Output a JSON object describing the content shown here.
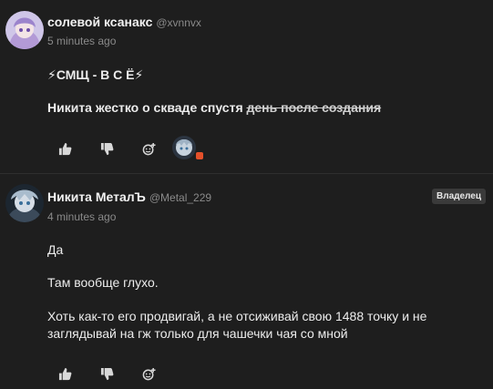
{
  "posts": [
    {
      "author": "солевой ксанакс",
      "handle": "@xvnnvx",
      "time": "5 minutes ago",
      "lines": {
        "l1": "⚡СМЩ - В С Ё⚡",
        "l2_main": "Никита жестко о скваде спустя",
        "l2_strike": "день после создания"
      }
    },
    {
      "author": "Никита МеталЪ",
      "handle": "@Metal_229",
      "time": "4 minutes ago",
      "badge": "Владелец",
      "lines": {
        "l1": "Да",
        "l2": "Там вообще глухо.",
        "l3a": "Хоть как-то его продвигай, а не отсиживай свою 1488 точку и не",
        "l3b": "заглядывай на гж только для чашечки чая со мной"
      }
    }
  ],
  "icons": {
    "like": "thumbs-up-icon",
    "dislike": "thumbs-down-icon",
    "react": "add-reaction-icon"
  },
  "colors": {
    "background": "#1e1e1e",
    "text": "#e6e6e6",
    "muted": "#8a8a8a",
    "reaction_dot": "#e4502a"
  }
}
